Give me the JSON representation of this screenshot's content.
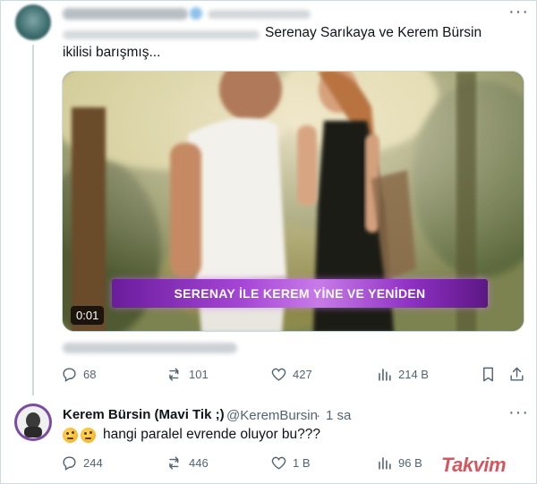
{
  "tweet1": {
    "text": "Serenay Sarıkaya ve Kerem Bürsin ikilisi barışmış...",
    "media": {
      "caption": "SERENAY İLE KEREM YİNE VE YENİDEN",
      "timestamp": "0:01"
    },
    "actions": {
      "replies": "68",
      "retweets": "101",
      "likes": "427",
      "views": "214 B"
    }
  },
  "tweet2": {
    "display_name": "Kerem Bürsin (Mavi Tik ;)",
    "handle": "@KeremBursin",
    "separator": "·",
    "time": "1 sa",
    "text": "hangi paralel evrende oluyor bu???",
    "actions": {
      "replies": "244",
      "retweets": "446",
      "likes": "1 B",
      "views": "96 B"
    }
  },
  "icons": {
    "reply": "reply-icon",
    "retweet": "retweet-icon",
    "like": "heart-icon",
    "views": "views-icon",
    "bookmark": "bookmark-icon",
    "share": "share-icon",
    "more": "more-icon"
  },
  "watermark": "Takvim",
  "colors": {
    "text_primary": "#0f1419",
    "text_secondary": "#536471",
    "caption_bar": "#a646d6"
  }
}
